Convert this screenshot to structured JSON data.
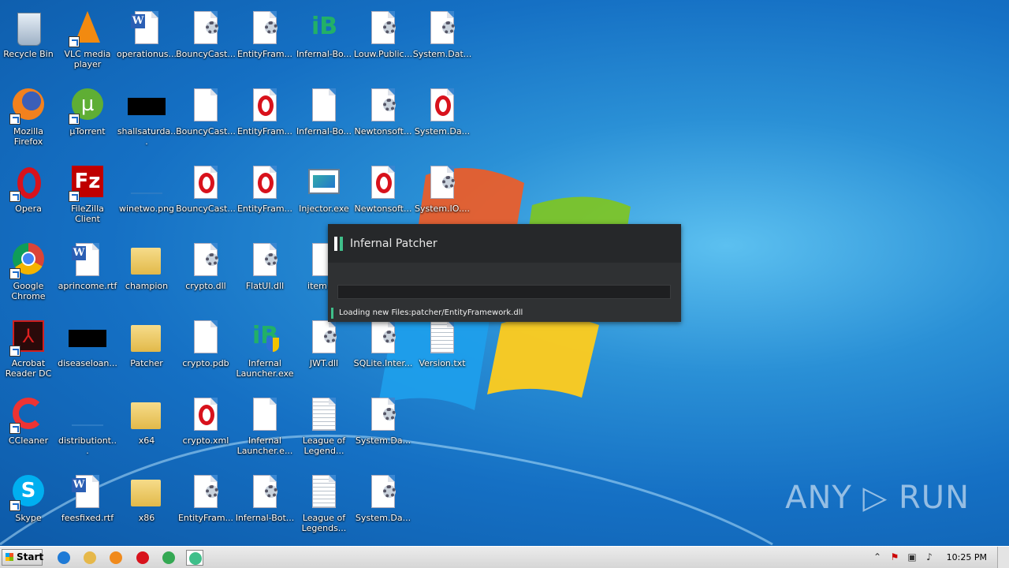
{
  "desktop": {
    "icons": [
      {
        "label": "Recycle Bin",
        "icon": "recycle-bin-icon"
      },
      {
        "label": "VLC media player",
        "icon": "vlc-icon"
      },
      {
        "label": "operationus...",
        "icon": "word-doc-icon"
      },
      {
        "label": "BouncyCast...",
        "icon": "dll-gear-icon"
      },
      {
        "label": "EntityFram...",
        "icon": "dll-gear-icon"
      },
      {
        "label": "Infernal-Bo...",
        "icon": "infernal-bot-icon"
      },
      {
        "label": "Louw.Public...",
        "icon": "dll-gear-icon"
      },
      {
        "label": "System.Dat...",
        "icon": "dll-gear-icon"
      },
      {
        "label": "Mozilla Firefox",
        "icon": "firefox-icon"
      },
      {
        "label": "µTorrent",
        "icon": "utorrent-icon"
      },
      {
        "label": "shallsaturda...",
        "icon": "black-image-icon"
      },
      {
        "label": "BouncyCast...",
        "icon": "blank-file-icon"
      },
      {
        "label": "EntityFram...",
        "icon": "opera-file-icon"
      },
      {
        "label": "Infernal-Bo...",
        "icon": "blank-file-icon"
      },
      {
        "label": "Newtonsoft...",
        "icon": "dll-gear-icon"
      },
      {
        "label": "System.Da...",
        "icon": "opera-file-icon"
      },
      {
        "label": "Opera",
        "icon": "opera-icon"
      },
      {
        "label": "FileZilla Client",
        "icon": "filezilla-icon"
      },
      {
        "label": "winetwo.png",
        "icon": "image-file-icon"
      },
      {
        "label": "BouncyCast...",
        "icon": "opera-file-icon"
      },
      {
        "label": "EntityFram...",
        "icon": "opera-file-icon"
      },
      {
        "label": "Injector.exe",
        "icon": "exe-window-icon"
      },
      {
        "label": "Newtonsoft...",
        "icon": "opera-file-icon"
      },
      {
        "label": "System.IO....",
        "icon": "dll-gear-icon"
      },
      {
        "label": "Google Chrome",
        "icon": "chrome-icon"
      },
      {
        "label": "aprincome.rtf",
        "icon": "word-doc-icon"
      },
      {
        "label": "champion",
        "icon": "folder-icon"
      },
      {
        "label": "crypto.dll",
        "icon": "dll-gear-icon"
      },
      {
        "label": "FlatUI.dll",
        "icon": "dll-gear-icon"
      },
      {
        "label": "item.j...",
        "icon": "blank-file-icon"
      },
      {
        "label": "Acrobat Reader DC",
        "icon": "acrobat-icon"
      },
      {
        "label": "diseaseloan...",
        "icon": "black-image-icon"
      },
      {
        "label": "Patcher",
        "icon": "folder-icon"
      },
      {
        "label": "crypto.pdb",
        "icon": "blank-file-icon"
      },
      {
        "label": "Infernal Launcher.exe",
        "icon": "infernal-launcher-icon"
      },
      {
        "label": "JWT.dll",
        "icon": "dll-gear-icon"
      },
      {
        "label": "SQLite.Inter...",
        "icon": "dll-gear-icon"
      },
      {
        "label": "Version.txt",
        "icon": "text-file-icon"
      },
      {
        "label": "CCleaner",
        "icon": "ccleaner-icon"
      },
      {
        "label": "distributiont...",
        "icon": "image-file-icon"
      },
      {
        "label": "x64",
        "icon": "folder-icon"
      },
      {
        "label": "crypto.xml",
        "icon": "opera-file-icon"
      },
      {
        "label": "Infernal Launcher.e...",
        "icon": "blank-file-icon"
      },
      {
        "label": "League of Legend...",
        "icon": "text-file-icon"
      },
      {
        "label": "System.Da...",
        "icon": "dll-gear-icon"
      },
      {
        "label": "Skype",
        "icon": "skype-icon"
      },
      {
        "label": "feesfixed.rtf",
        "icon": "word-doc-icon"
      },
      {
        "label": "x86",
        "icon": "folder-icon"
      },
      {
        "label": "EntityFram...",
        "icon": "dll-gear-icon"
      },
      {
        "label": "Infernal-Bot...",
        "icon": "dll-gear-icon"
      },
      {
        "label": "League of Legends...",
        "icon": "text-file-icon"
      },
      {
        "label": "System.Da...",
        "icon": "dll-gear-icon"
      }
    ]
  },
  "patcher": {
    "title": "Infernal Patcher",
    "progress": 0,
    "status": "Loading new Files:patcher/EntityFramework.dll",
    "accent_color": "#3fbf8a"
  },
  "watermark": "ANY ▷ RUN",
  "taskbar": {
    "start_label": "Start",
    "pinned": [
      {
        "name": "internet-explorer-icon",
        "color": "#1e7ad6"
      },
      {
        "name": "explorer-folder-icon",
        "color": "#e6b84a"
      },
      {
        "name": "media-player-icon",
        "color": "#f08a1c"
      },
      {
        "name": "opera-icon",
        "color": "#d8121c"
      },
      {
        "name": "chrome-icon",
        "color": "#34a853"
      },
      {
        "name": "infernal-patcher-icon",
        "color": "#3fbf8a"
      }
    ],
    "clock": "10:25 PM"
  }
}
